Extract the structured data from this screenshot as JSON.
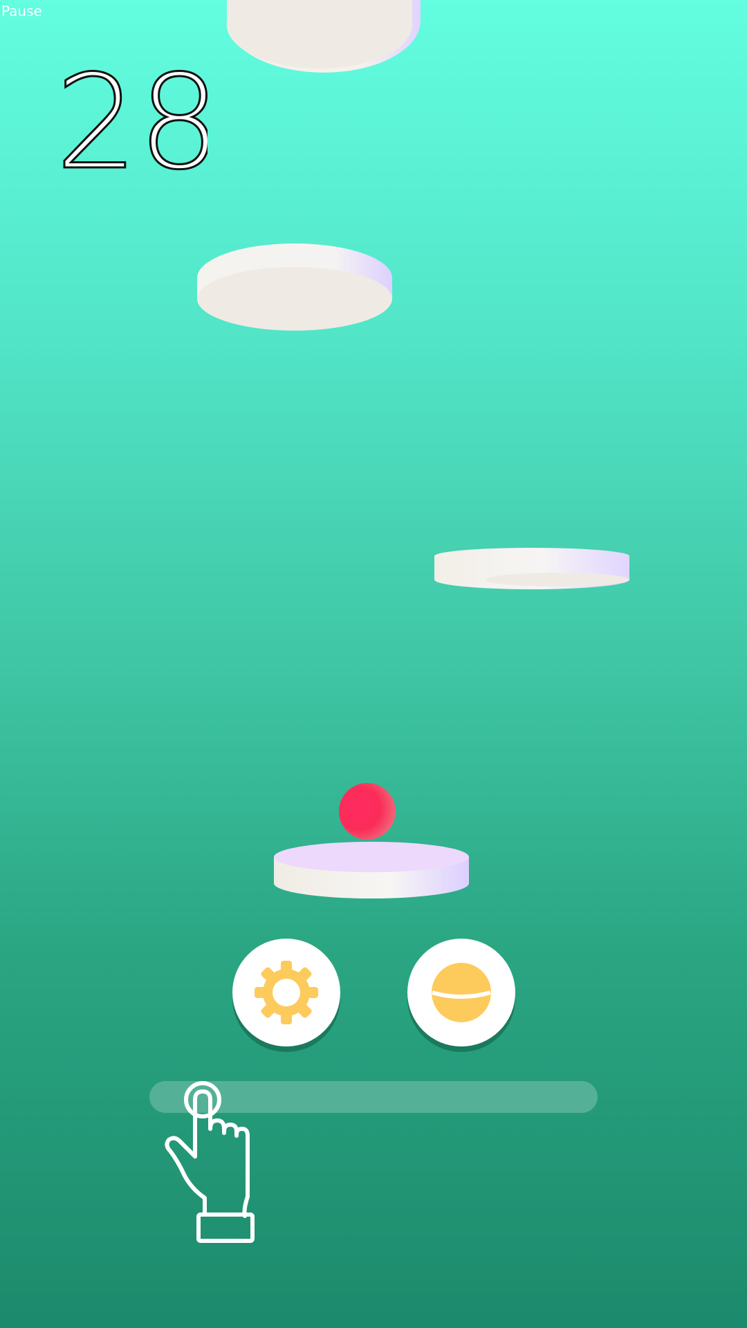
{
  "hud": {
    "pause_label": "Pause",
    "score": "28"
  },
  "game": {
    "ball_color": "#fb2d58",
    "platform_color": "#f1ede7",
    "platform_edge_tint": "#e3d9ff"
  },
  "controls": {
    "settings_icon": "gear-icon",
    "skin_icon": "ball-skin-icon",
    "accent_color": "#fdcb5c"
  },
  "tutorial": {
    "hint_icon": "tap-hand-icon"
  }
}
